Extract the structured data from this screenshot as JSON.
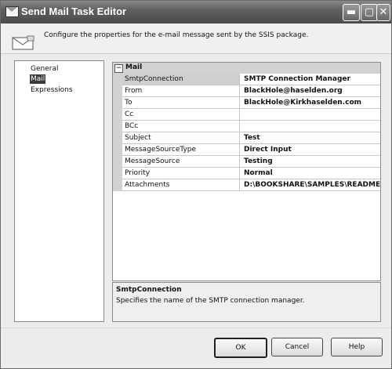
{
  "window": {
    "title": "Send Mail Task Editor"
  },
  "header": {
    "description": "Configure the properties for the e-mail message sent by the SSIS package."
  },
  "nav": {
    "items": [
      "General",
      "Mail",
      "Expressions"
    ],
    "selected": "Mail"
  },
  "grid": {
    "category": "Mail",
    "properties": [
      {
        "name": "SmtpConnection",
        "value": "SMTP Connection Manager"
      },
      {
        "name": "From",
        "value": "BlackHole@haselden.org"
      },
      {
        "name": "To",
        "value": "BlackHole@Kirkhaselden.com"
      },
      {
        "name": "Cc",
        "value": ""
      },
      {
        "name": "BCc",
        "value": ""
      },
      {
        "name": "Subject",
        "value": "Test"
      },
      {
        "name": "MessageSourceType",
        "value": "Direct Input"
      },
      {
        "name": "MessageSource",
        "value": "Testing"
      },
      {
        "name": "Priority",
        "value": "Normal"
      },
      {
        "name": "Attachments",
        "value": "D:\\BOOKSHARE\\SAMPLES\\README.T"
      }
    ]
  },
  "description_panel": {
    "title": "SmtpConnection",
    "text": "Specifies the name of the SMTP connection manager."
  },
  "buttons": {
    "ok": "OK",
    "cancel": "Cancel",
    "help": "Help"
  },
  "icons": {
    "app": "mail-window-icon",
    "header": "mail-envelope-icon"
  }
}
